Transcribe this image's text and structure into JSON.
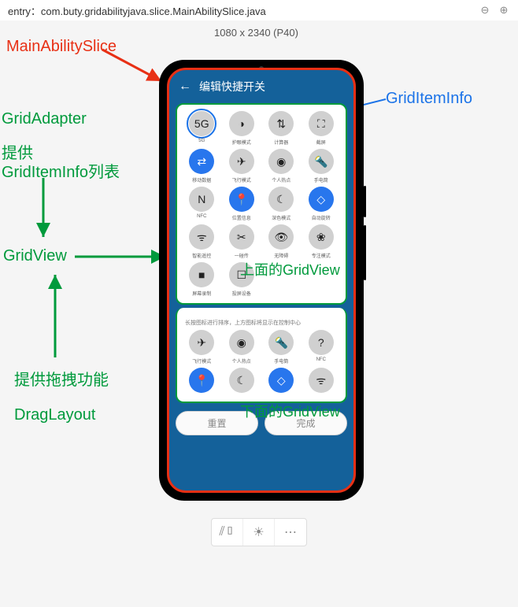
{
  "topbar": {
    "path": "entry：com.buty.gridabilityjava.slice.MainAbilitySlice.java"
  },
  "canvas": {
    "dimensions": "1080 x 2340 (P40)"
  },
  "annotations": {
    "main_ability_slice": "MainAbilitySlice",
    "grid_item_info": "GridItemInfo",
    "grid_adapter": "GridAdapter",
    "grid_adapter_sub": "提供",
    "grid_adapter_sub2": "GridItemInfo列表",
    "grid_view": "GridView",
    "drag_layout_sub": "提供拖拽功能",
    "drag_layout": "DragLayout",
    "upper_gridview_overlay": "上面的GridView",
    "lower_gridview_overlay": "下面的GridView"
  },
  "phone": {
    "header": {
      "title": "编辑快捷开关"
    },
    "upperGrid": [
      {
        "icon": "5G",
        "label": "5G",
        "style": "hiblue"
      },
      {
        "icon": "◑",
        "label": "护眼模式",
        "style": ""
      },
      {
        "icon": "⇅",
        "label": "计算器",
        "style": ""
      },
      {
        "icon": "⛶",
        "label": "截屏",
        "style": ""
      },
      {
        "icon": "⇄",
        "label": "移动数据",
        "style": "blue"
      },
      {
        "icon": "✈",
        "label": "飞行模式",
        "style": ""
      },
      {
        "icon": "◉",
        "label": "个人热点",
        "style": ""
      },
      {
        "icon": "🔦",
        "label": "手电筒",
        "style": ""
      },
      {
        "icon": "N",
        "label": "NFC",
        "style": ""
      },
      {
        "icon": "📍",
        "label": "位置信息",
        "style": "blue"
      },
      {
        "icon": "☾",
        "label": "深色模式",
        "style": ""
      },
      {
        "icon": "◇",
        "label": "自动旋转",
        "style": "blue"
      },
      {
        "icon": "ᯤ",
        "label": "智能遥控",
        "style": ""
      },
      {
        "icon": "✂",
        "label": "一碰传",
        "style": ""
      },
      {
        "icon": "👁",
        "label": "无障碍",
        "style": ""
      },
      {
        "icon": "❀",
        "label": "专注模式",
        "style": ""
      },
      {
        "icon": "■",
        "label": "屏幕录制",
        "style": ""
      },
      {
        "icon": "☐",
        "label": "投屏设备",
        "style": ""
      }
    ],
    "hint": "长按图标进行排序，上方图标将显示在控制中心",
    "lowerGrid": [
      {
        "icon": "✈",
        "label": "飞行模式",
        "style": ""
      },
      {
        "icon": "◉",
        "label": "个人热点",
        "style": ""
      },
      {
        "icon": "🔦",
        "label": "手电筒",
        "style": ""
      },
      {
        "icon": "?",
        "label": "NFC",
        "style": ""
      },
      {
        "icon": "📍",
        "label": "",
        "style": "blue"
      },
      {
        "icon": "☾",
        "label": "",
        "style": ""
      },
      {
        "icon": "◇",
        "label": "",
        "style": "blue"
      },
      {
        "icon": "ᯤ",
        "label": "",
        "style": ""
      }
    ],
    "buttons": {
      "reset": "重置",
      "done": "完成"
    }
  },
  "toolbar": {
    "rotate": "⟳",
    "brightness": "☀",
    "more": "⋯"
  }
}
